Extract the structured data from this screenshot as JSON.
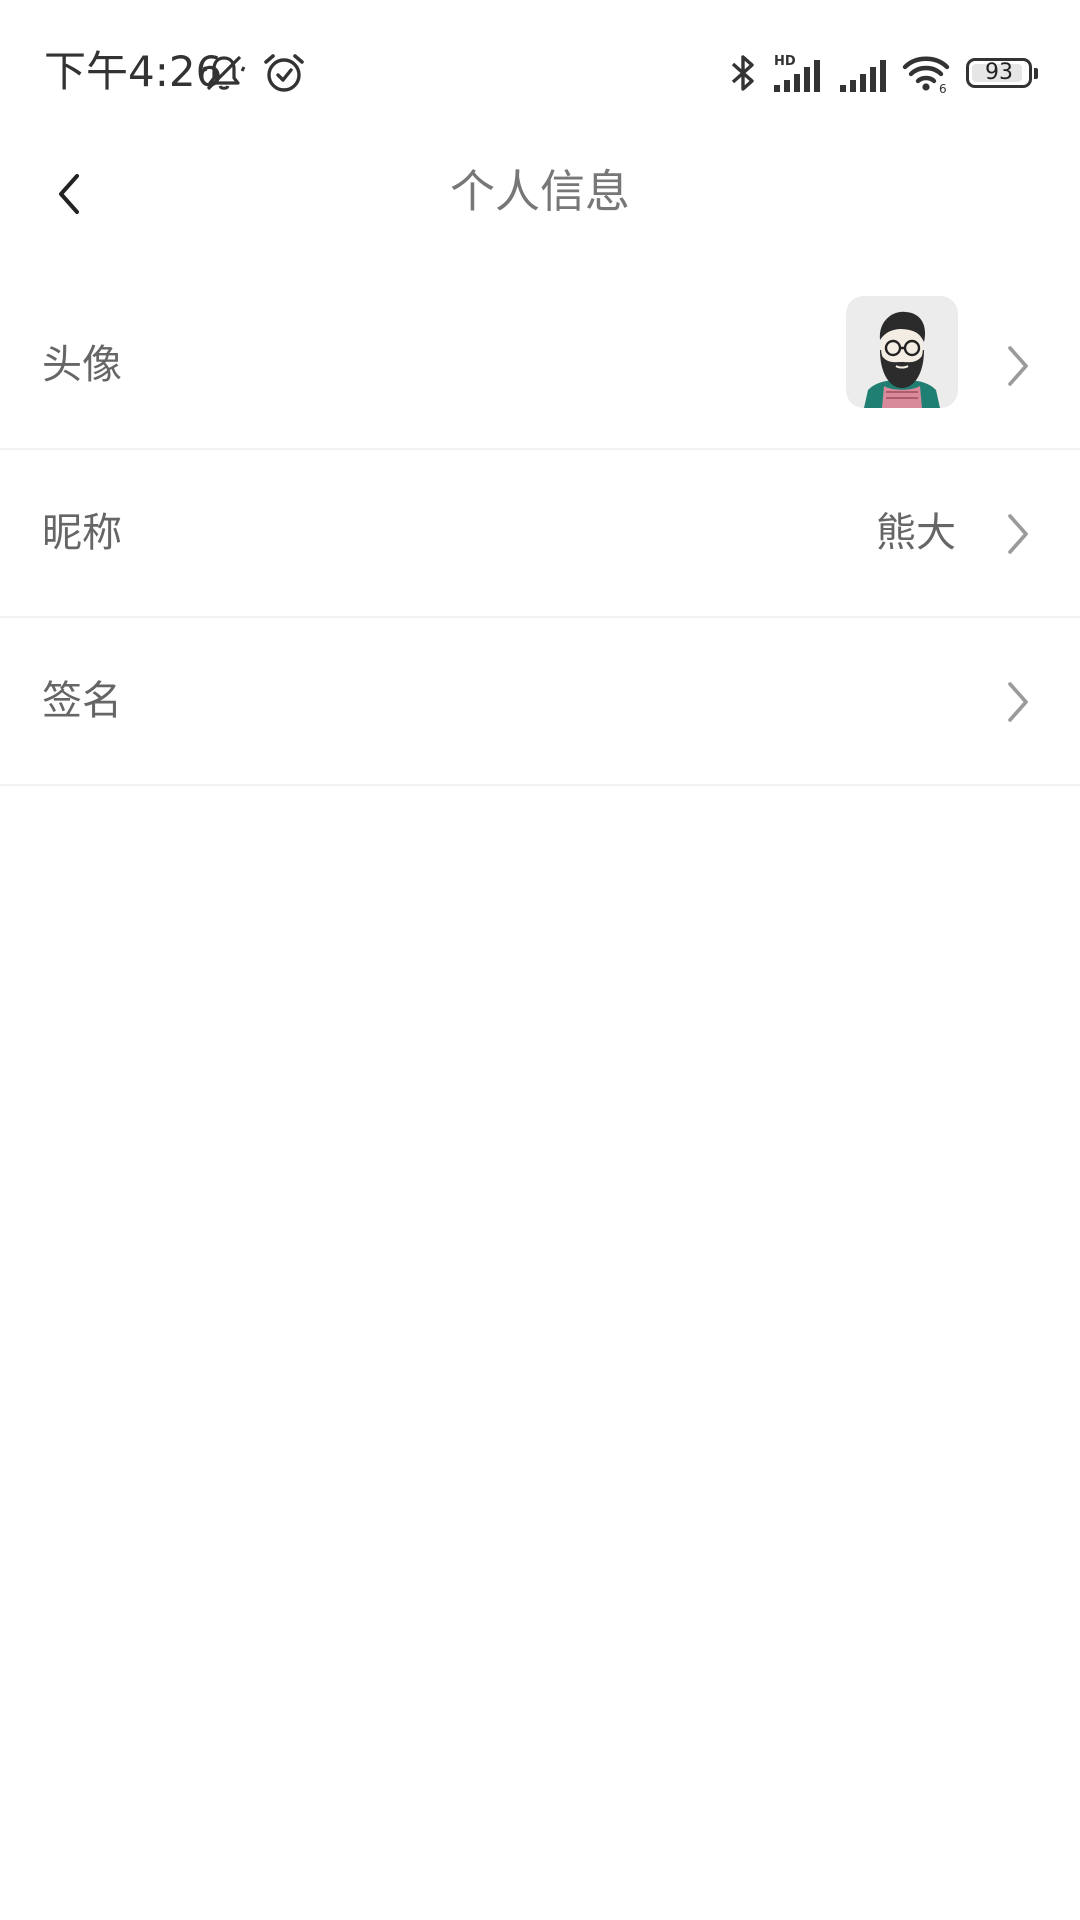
{
  "status_bar": {
    "time": "下午4:26",
    "battery": "93",
    "battery_level": 0.93,
    "left_icons": [
      "mute-icon",
      "alarm-icon"
    ],
    "right_icons": [
      "bluetooth-icon",
      "hd-signal-icon",
      "signal-icon",
      "wifi-icon",
      "battery-icon"
    ]
  },
  "nav": {
    "title": "个人信息",
    "back_icon": "chevron-left-icon"
  },
  "rows": [
    {
      "label": "头像",
      "value": "",
      "has_avatar": true
    },
    {
      "label": "昵称",
      "value": "熊大"
    },
    {
      "label": "签名",
      "value": ""
    }
  ],
  "colors": {
    "background": "#ffffff",
    "text": "#666666",
    "title": "#777777",
    "divider": "#f2f2f2",
    "chevron": "#9a9a9a"
  }
}
